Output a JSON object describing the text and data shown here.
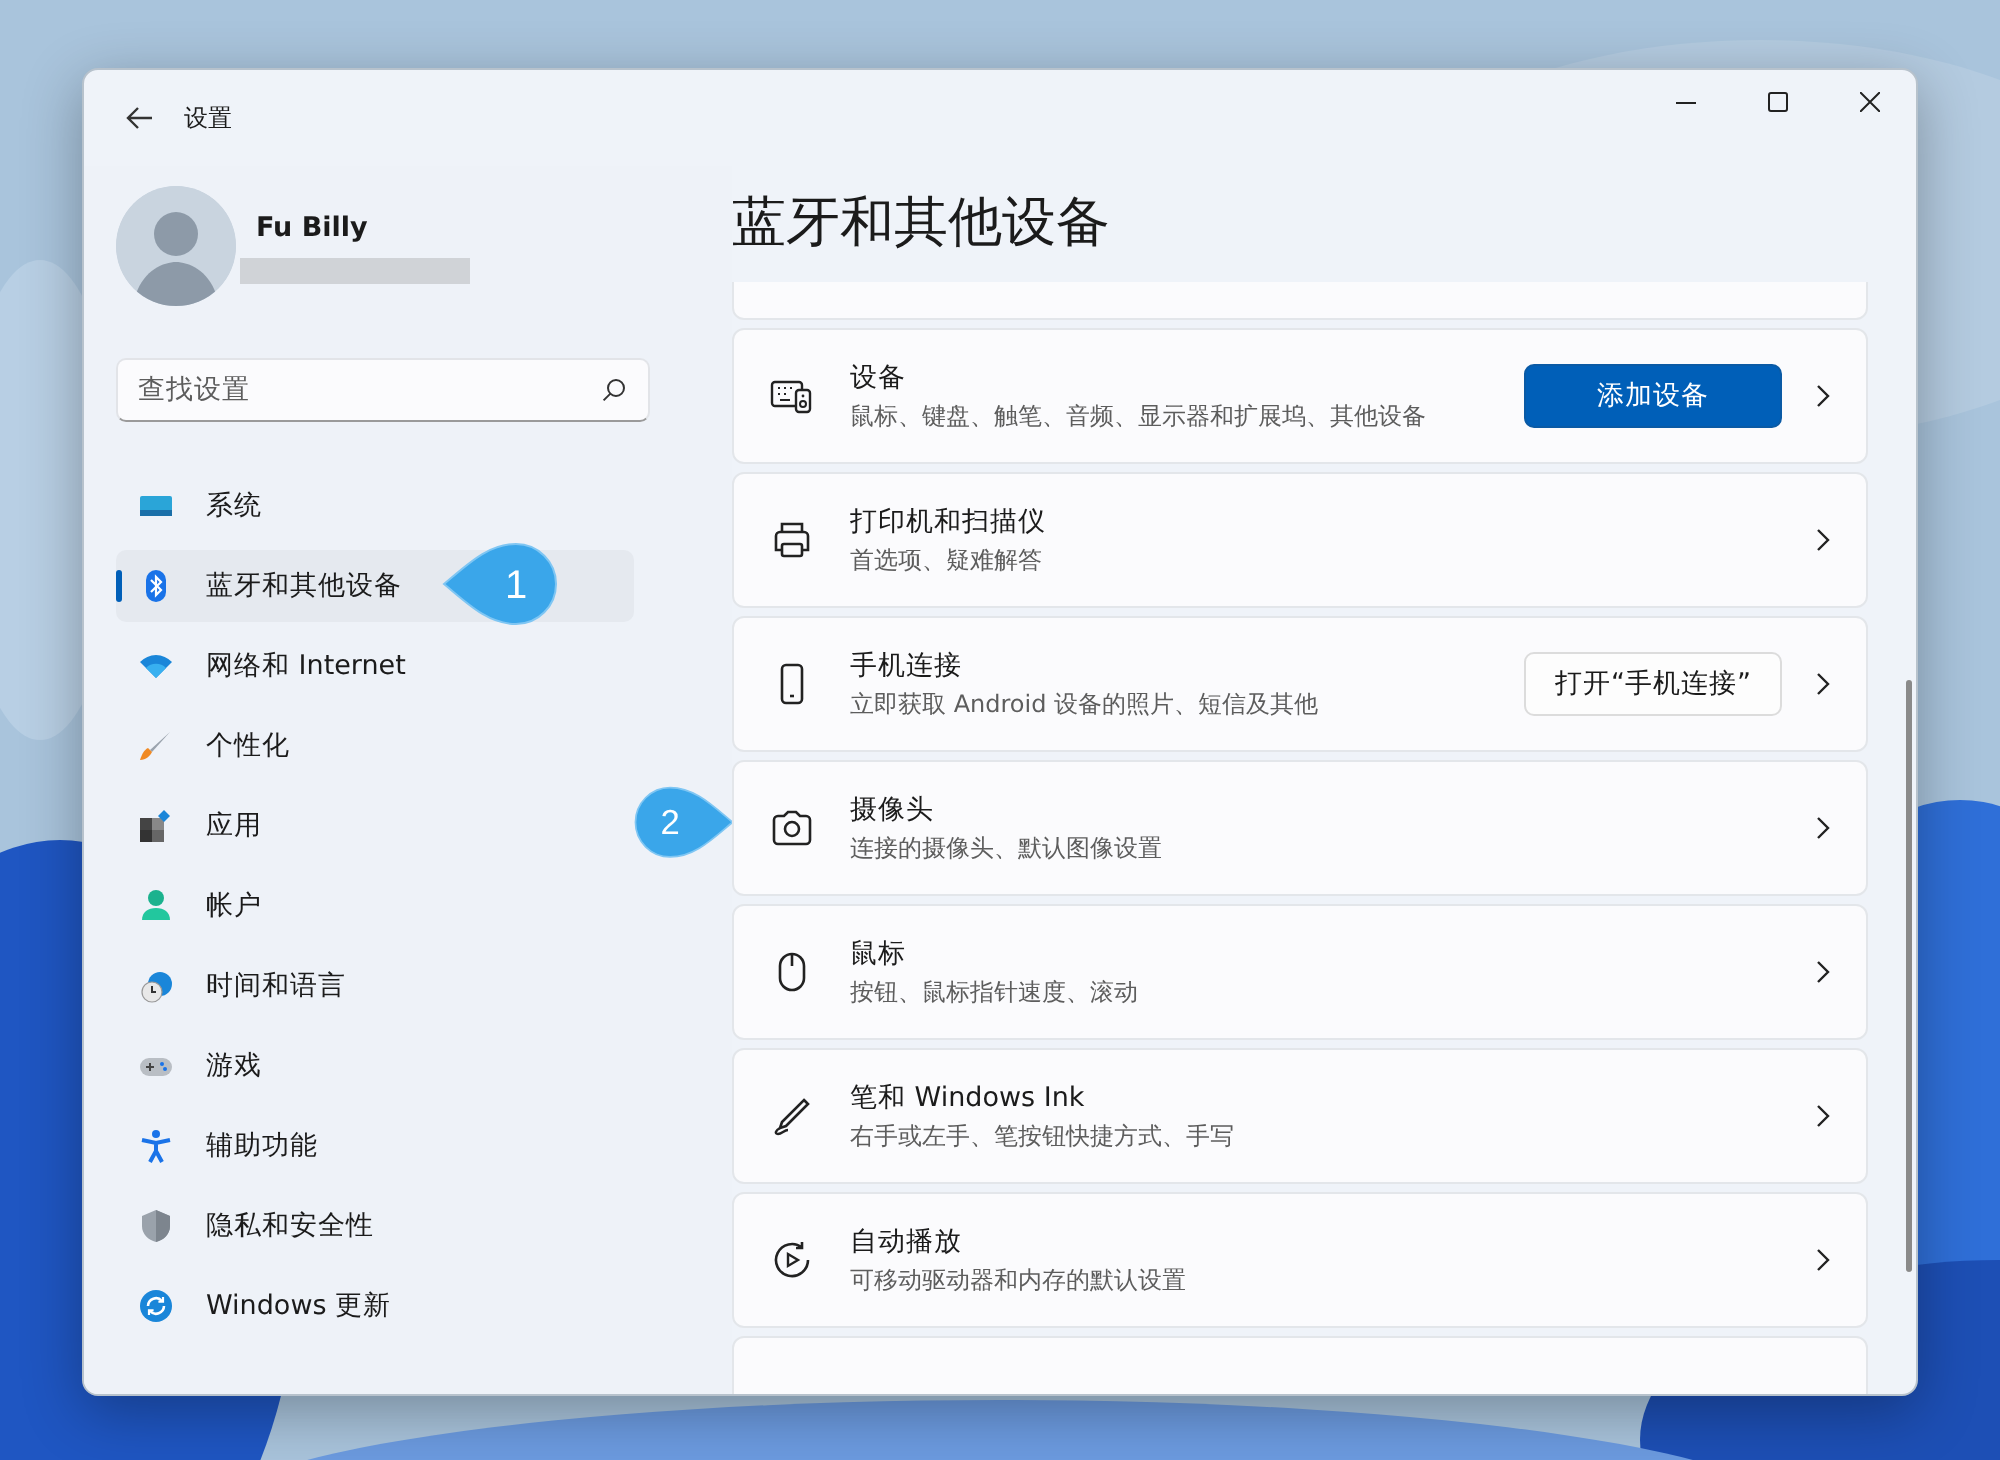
{
  "window": {
    "title": "设置"
  },
  "user": {
    "name": "Fu Billy"
  },
  "search": {
    "placeholder": "查找设置"
  },
  "nav": [
    {
      "kind": "system",
      "label": "系统",
      "selected": false
    },
    {
      "kind": "bluetooth",
      "label": "蓝牙和其他设备",
      "selected": true,
      "callout": "1"
    },
    {
      "kind": "network",
      "label": "网络和 Internet",
      "selected": false
    },
    {
      "kind": "personalization",
      "label": "个性化",
      "selected": false
    },
    {
      "kind": "apps",
      "label": "应用",
      "selected": false
    },
    {
      "kind": "accounts",
      "label": "帐户",
      "selected": false
    },
    {
      "kind": "time",
      "label": "时间和语言",
      "selected": false
    },
    {
      "kind": "gaming",
      "label": "游戏",
      "selected": false
    },
    {
      "kind": "accessibility",
      "label": "辅助功能",
      "selected": false
    },
    {
      "kind": "privacy",
      "label": "隐私和安全性",
      "selected": false
    },
    {
      "kind": "update",
      "label": "Windows 更新",
      "selected": false
    }
  ],
  "page_title": "蓝牙和其他设备",
  "cards": [
    {
      "kind": "devices",
      "title": "设备",
      "subtitle": "鼠标、键盘、触笔、音频、显示器和扩展坞、其他设备",
      "button": {
        "label": "添加设备",
        "primary": true
      }
    },
    {
      "kind": "printer",
      "title": "打印机和扫描仪",
      "subtitle": "首选项、疑难解答"
    },
    {
      "kind": "phone",
      "title": "手机连接",
      "subtitle": "立即获取 Android 设备的照片、短信及其他",
      "button": {
        "label": "打开“手机连接”",
        "primary": false
      }
    },
    {
      "kind": "camera",
      "title": "摄像头",
      "subtitle": "连接的摄像头、默认图像设置",
      "callout": "2"
    },
    {
      "kind": "mouse",
      "title": "鼠标",
      "subtitle": "按钮、鼠标指针速度、滚动"
    },
    {
      "kind": "pen",
      "title": "笔和 Windows Ink",
      "subtitle": "右手或左手、笔按钮快捷方式、手写"
    },
    {
      "kind": "autoplay",
      "title": "自动播放",
      "subtitle": "可移动驱动器和内存的默认设置"
    }
  ]
}
